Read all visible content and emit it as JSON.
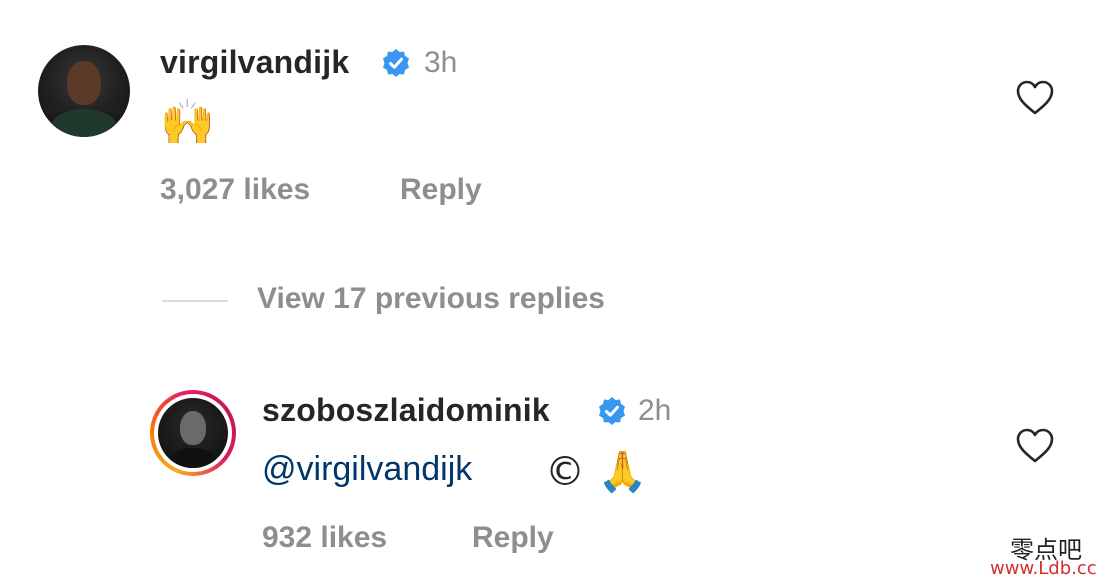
{
  "comment": {
    "username": "virgilvandijk",
    "verified_icon": "verified-badge-icon",
    "time": "3h",
    "text": "🙌",
    "likes": "3,027 likes",
    "reply_label": "Reply",
    "like_icon": "heart-outline-icon"
  },
  "view_replies": {
    "label": "View 17 previous replies"
  },
  "reply": {
    "username": "szoboszlaidominik",
    "verified_icon": "verified-badge-icon",
    "time": "2h",
    "mention": "@virgilvandijk",
    "text_symbols": "© 🙏",
    "likes": "932 likes",
    "reply_label": "Reply",
    "like_icon": "heart-outline-icon",
    "story_ring_colors": [
      "#f9a825",
      "#e91e63"
    ]
  },
  "watermark": {
    "cn": "零点吧",
    "url": "www.Ldb.cc"
  },
  "colors": {
    "text": "#262626",
    "secondary": "#8e8e8e",
    "mention": "#00376b",
    "verified": "#3897f0"
  }
}
